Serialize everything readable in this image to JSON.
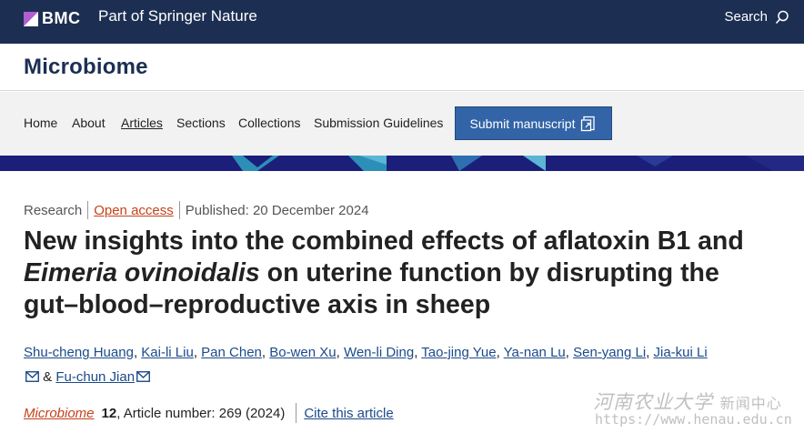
{
  "header": {
    "logo_text": "BMC",
    "tagline": "Part of Springer Nature",
    "search_label": "Search"
  },
  "journal": {
    "name": "Microbiome"
  },
  "nav": {
    "items": [
      "Home",
      "About",
      "Articles",
      "Sections",
      "Collections",
      "Submission Guidelines"
    ],
    "active": "Articles",
    "submit_label": "Submit manuscript"
  },
  "article": {
    "type": "Research",
    "access": "Open access",
    "published": "Published: 20 December 2024",
    "title_part1": "New insights into the combined effects of aflatoxin B1 and ",
    "title_italic": "Eimeria ovinoidalis",
    "title_part2": " on uterine function by disrupting the gut–blood–reproductive axis in sheep",
    "authors": [
      "Shu-cheng Huang",
      "Kai-li Liu",
      "Pan Chen",
      "Bo-wen Xu",
      "Wen-li Ding",
      "Tao-jing Yue",
      "Ya-nan Lu",
      "Sen-yang Li",
      "Jia-kui Li",
      "Fu-chun Jian"
    ],
    "author_joiner": "&",
    "journal_name": "Microbiome",
    "volume": "12",
    "article_number": ", Article number: 269 (2024)",
    "cite_label": "Cite this article"
  },
  "watermark": {
    "line1": "河南农业大学",
    "line1_suffix": "新闻中心",
    "line2": "https://www.henau.edu.cn"
  }
}
